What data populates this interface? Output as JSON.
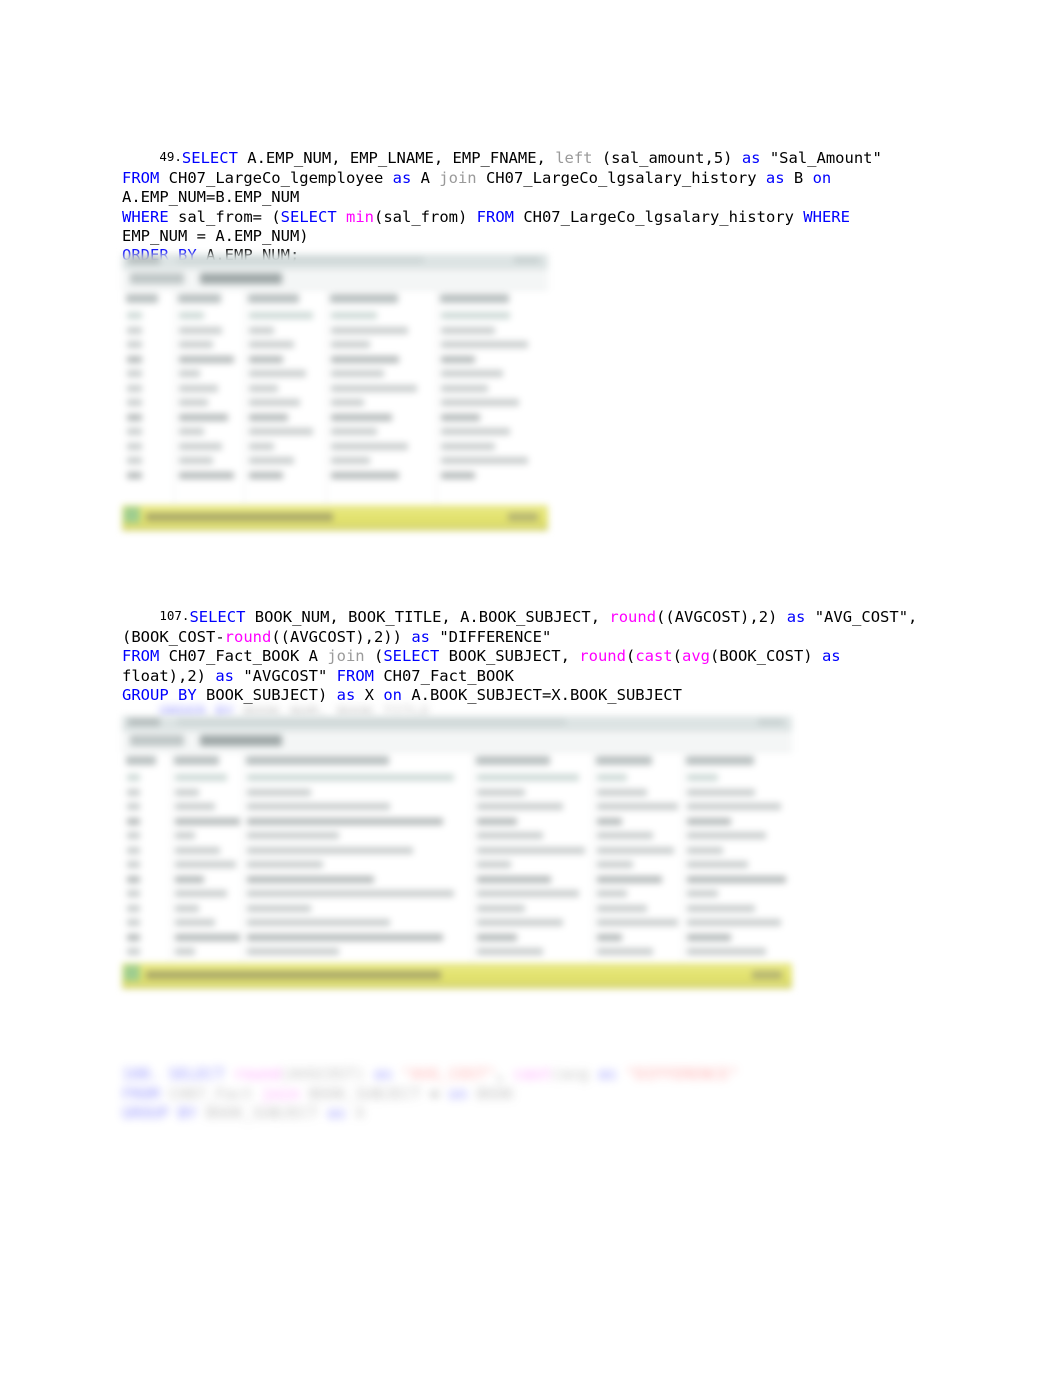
{
  "document": {
    "type": "sql-assignment-answers",
    "page_background": "#ffffff"
  },
  "colors": {
    "keyword": "#0000ff",
    "function": "#ff00ff",
    "dimmed_keyword": "#9a9a9a",
    "plain_text": "#000000",
    "status_bar": "#e2e26a",
    "status_bar_icon": "#9fce8f"
  },
  "queries": [
    {
      "number": "49.",
      "full_text": "SELECT A.EMP_NUM, EMP_LNAME, EMP_FNAME, left (sal_amount,5) as \"Sal_Amount\"\nFROM CH07_LargeCo_lgemployee as A join CH07_LargeCo_lgsalary_history as B on\nA.EMP_NUM=B.EMP_NUM\nWHERE sal_from= (SELECT min(sal_from) FROM CH07_LargeCo_lgsalary_history WHERE\nEMP_NUM = A.EMP_NUM)\nORDER BY A.EMP_NUM;",
      "tokens": [
        {
          "t": "SELECT",
          "c": "kw"
        },
        {
          "t": " A.EMP_NUM, EMP_LNAME, EMP_FNAME, ",
          "c": "txt"
        },
        {
          "t": "left",
          "c": "dim"
        },
        {
          "t": " (sal_amount,5) ",
          "c": "txt"
        },
        {
          "t": "as",
          "c": "kw"
        },
        {
          "t": " \"Sal_Amount\"\n",
          "c": "txt"
        },
        {
          "t": "FROM",
          "c": "kw"
        },
        {
          "t": " CH07_LargeCo_lgemployee ",
          "c": "txt"
        },
        {
          "t": "as",
          "c": "kw"
        },
        {
          "t": " A ",
          "c": "txt"
        },
        {
          "t": "join",
          "c": "dim"
        },
        {
          "t": " CH07_LargeCo_lgsalary_history ",
          "c": "txt"
        },
        {
          "t": "as",
          "c": "kw"
        },
        {
          "t": " B ",
          "c": "txt"
        },
        {
          "t": "on",
          "c": "kw"
        },
        {
          "t": "\nA.EMP_NUM=B.EMP_NUM\n",
          "c": "txt"
        },
        {
          "t": "WHERE",
          "c": "kw"
        },
        {
          "t": " sal_from= (",
          "c": "txt"
        },
        {
          "t": "SELECT",
          "c": "kw"
        },
        {
          "t": " ",
          "c": "txt"
        },
        {
          "t": "min",
          "c": "fn"
        },
        {
          "t": "(sal_from) ",
          "c": "txt"
        },
        {
          "t": "FROM",
          "c": "kw"
        },
        {
          "t": " CH07_LargeCo_lgsalary_history ",
          "c": "txt"
        },
        {
          "t": "WHERE",
          "c": "kw"
        },
        {
          "t": "\nEMP_NUM = A.EMP_NUM)\n",
          "c": "txt"
        },
        {
          "t": "ORDER BY",
          "c": "kw"
        },
        {
          "t": " A.EMP_NUM;",
          "c": "txt"
        }
      ],
      "result_screenshot": {
        "name": "ssms-result-grid-49",
        "blurred": true,
        "columns": 5,
        "rows": 12,
        "status_bar_visible": true
      }
    },
    {
      "number": "107.",
      "full_text": "SELECT BOOK_NUM, BOOK_TITLE, A.BOOK_SUBJECT, round((AVGCOST),2) as \"AVG_COST\",\n(BOOK_COST-round((AVGCOST),2)) as \"DIFFERENCE\"\nFROM CH07_Fact_BOOK A join (SELECT BOOK_SUBJECT, round(cast(avg(BOOK_COST) as\nfloat),2) as \"AVGCOST\" FROM CH07_Fact_BOOK\nGROUP BY BOOK_SUBJECT) as X on A.BOOK_SUBJECT=X.BOOK_SUBJECT",
      "tokens": [
        {
          "t": "SELECT",
          "c": "kw"
        },
        {
          "t": " BOOK_NUM, BOOK_TITLE, A.BOOK_SUBJECT, ",
          "c": "txt"
        },
        {
          "t": "round",
          "c": "fn"
        },
        {
          "t": "((AVGCOST),2) ",
          "c": "txt"
        },
        {
          "t": "as",
          "c": "kw"
        },
        {
          "t": " \"AVG_COST\",\n(BOOK_COST-",
          "c": "txt"
        },
        {
          "t": "round",
          "c": "fn"
        },
        {
          "t": "((AVGCOST),2)) ",
          "c": "txt"
        },
        {
          "t": "as",
          "c": "kw"
        },
        {
          "t": " \"DIFFERENCE\"\n",
          "c": "txt"
        },
        {
          "t": "FROM",
          "c": "kw"
        },
        {
          "t": " CH07_Fact_BOOK A ",
          "c": "txt"
        },
        {
          "t": "join",
          "c": "dim"
        },
        {
          "t": " (",
          "c": "txt"
        },
        {
          "t": "SELECT",
          "c": "kw"
        },
        {
          "t": " BOOK_SUBJECT, ",
          "c": "txt"
        },
        {
          "t": "round",
          "c": "fn"
        },
        {
          "t": "(",
          "c": "txt"
        },
        {
          "t": "cast",
          "c": "fn"
        },
        {
          "t": "(",
          "c": "txt"
        },
        {
          "t": "avg",
          "c": "fn"
        },
        {
          "t": "(BOOK_COST) ",
          "c": "txt"
        },
        {
          "t": "as",
          "c": "kw"
        },
        {
          "t": "\nfloat),2) ",
          "c": "txt"
        },
        {
          "t": "as",
          "c": "kw"
        },
        {
          "t": " \"AVGCOST\" ",
          "c": "txt"
        },
        {
          "t": "FROM",
          "c": "kw"
        },
        {
          "t": " CH07_Fact_BOOK\n",
          "c": "txt"
        },
        {
          "t": "GROUP BY",
          "c": "kw"
        },
        {
          "t": " BOOK_SUBJECT) ",
          "c": "txt"
        },
        {
          "t": "as",
          "c": "kw"
        },
        {
          "t": " X ",
          "c": "txt"
        },
        {
          "t": "on",
          "c": "kw"
        },
        {
          "t": " A.BOOK_SUBJECT=X.BOOK_SUBJECT",
          "c": "txt"
        }
      ],
      "result_screenshot": {
        "name": "ssms-result-grid-107",
        "blurred": true,
        "columns": 5,
        "rows": 14,
        "status_bar_visible": true
      }
    }
  ],
  "partial_line_107": {
    "blurred": true,
    "note": "illegible blurred continuation line"
  },
  "blurred_fragment": {
    "blurred": true,
    "note": "illegible blurred SQL code fragment with red error-colored tokens",
    "lines": 3
  }
}
